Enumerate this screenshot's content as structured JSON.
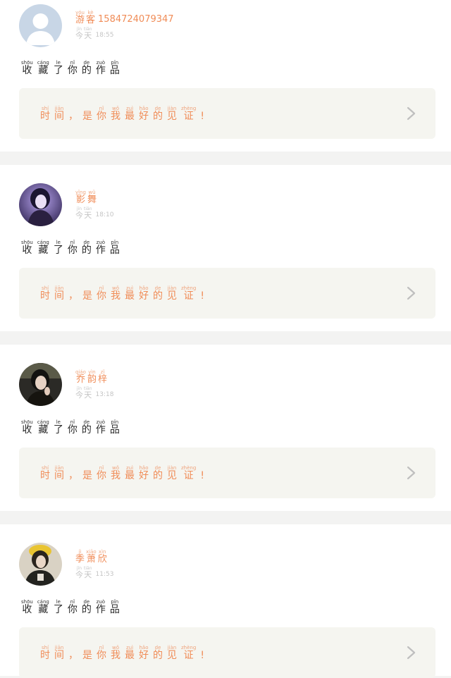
{
  "action": {
    "ruby": [
      {
        "py": "shōu",
        "hz": "收"
      },
      {
        "py": "cáng",
        "hz": "藏"
      },
      {
        "py": "le",
        "hz": "了"
      },
      {
        "py": "nǐ",
        "hz": "你"
      },
      {
        "py": "de",
        "hz": "的"
      },
      {
        "py": "zuò",
        "hz": "作"
      },
      {
        "py": "pǐn",
        "hz": "品"
      }
    ]
  },
  "work_title": {
    "ruby": [
      {
        "py": "shí",
        "hz": "时"
      },
      {
        "py": "jiān",
        "hz": "间"
      },
      {
        "py": "",
        "hz": "，"
      },
      {
        "py": "",
        "hz": "是"
      },
      {
        "py": "nǐ",
        "hz": "你"
      },
      {
        "py": "wǒ",
        "hz": "我"
      },
      {
        "py": "zuì",
        "hz": "最"
      },
      {
        "py": "hǎo",
        "hz": "好"
      },
      {
        "py": "de",
        "hz": "的"
      },
      {
        "py": "jiàn",
        "hz": "见"
      },
      {
        "py": "zhèng",
        "hz": "证"
      },
      {
        "py": "",
        "hz": "!"
      }
    ]
  },
  "time_word": [
    {
      "py": "jīn",
      "hz": "今"
    },
    {
      "py": "tiān",
      "hz": "天"
    }
  ],
  "items": [
    {
      "name_ruby": [
        {
          "py": "yóu",
          "hz": "游"
        },
        {
          "py": "kè",
          "hz": "客"
        }
      ],
      "name_suffix": "15847240793​47",
      "time": "18:55",
      "avatar_type": "default"
    },
    {
      "name_ruby": [
        {
          "py": "yǐng",
          "hz": "影"
        },
        {
          "py": "wǔ",
          "hz": "舞"
        }
      ],
      "name_suffix": "",
      "time": "18:10",
      "avatar_type": "photo-purple"
    },
    {
      "name_ruby": [
        {
          "py": "qiáo",
          "hz": "乔"
        },
        {
          "py": "yìn",
          "hz": "韵"
        },
        {
          "py": "zǐ",
          "hz": "梓"
        }
      ],
      "name_suffix": "",
      "time": "13:18",
      "avatar_type": "photo-dark"
    },
    {
      "name_ruby": [
        {
          "py": "jì",
          "hz": "季"
        },
        {
          "py": "xiāo",
          "hz": "萧"
        },
        {
          "py": "xìn",
          "hz": "欣"
        }
      ],
      "name_suffix": "",
      "time": "11:53",
      "avatar_type": "photo-yellow"
    }
  ]
}
